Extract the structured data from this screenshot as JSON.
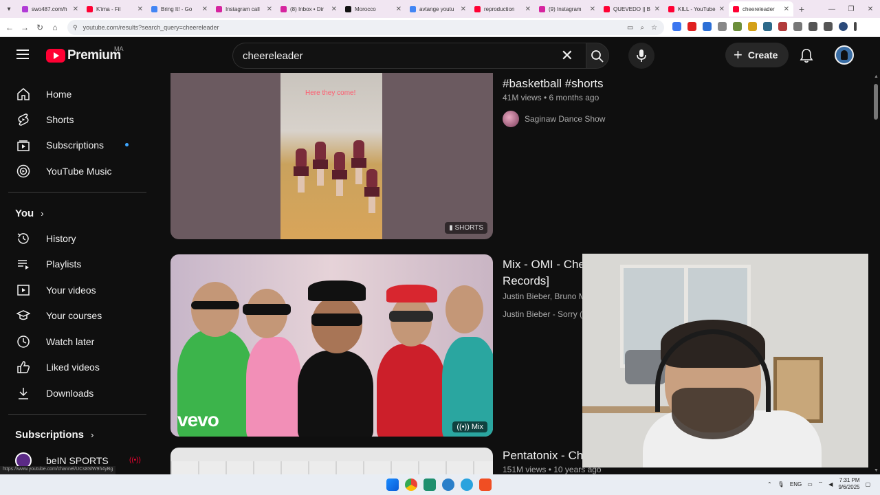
{
  "browser": {
    "tabs": [
      {
        "label": "swo487.com/h",
        "color": "#b13bd6"
      },
      {
        "label": "K'ima - Fil",
        "color": "#ff0033"
      },
      {
        "label": "Bring It! - Go",
        "color": "#4285f4"
      },
      {
        "label": "Instagram call",
        "color": "#d6249f"
      },
      {
        "label": "(8) Inbox • Dir",
        "color": "#d6249f"
      },
      {
        "label": "Morocco",
        "color": "#111111"
      },
      {
        "label": "avtange youtu",
        "color": "#4285f4"
      },
      {
        "label": "reproduction",
        "color": "#ff0033"
      },
      {
        "label": "(9) Instagram",
        "color": "#d6249f"
      },
      {
        "label": "QUEVEDO || B",
        "color": "#ff0033"
      },
      {
        "label": "KILL - YouTube",
        "color": "#ff0033"
      },
      {
        "label": "cheereleader",
        "color": "#ff0033",
        "active": true
      }
    ],
    "url": "youtube.com/results?search_query=cheereleader",
    "new_tab": "+"
  },
  "header": {
    "logo_text": "Premium",
    "country_code": "MA",
    "search_query": "cheereleader",
    "create_label": "Create"
  },
  "sidebar": {
    "main": [
      {
        "label": "Home",
        "icon": "home-icon"
      },
      {
        "label": "Shorts",
        "icon": "shorts-icon"
      },
      {
        "label": "Subscriptions",
        "icon": "subscriptions-icon"
      },
      {
        "label": "YouTube Music",
        "icon": "music-icon"
      }
    ],
    "you_heading": "You",
    "you": [
      {
        "label": "History",
        "icon": "history-icon"
      },
      {
        "label": "Playlists",
        "icon": "playlists-icon"
      },
      {
        "label": "Your videos",
        "icon": "your-videos-icon"
      },
      {
        "label": "Your courses",
        "icon": "courses-icon"
      },
      {
        "label": "Watch later",
        "icon": "clock-icon"
      },
      {
        "label": "Liked videos",
        "icon": "thumb-up-icon"
      },
      {
        "label": "Downloads",
        "icon": "download-icon"
      }
    ],
    "subscriptions_heading": "Subscriptions",
    "subscriptions": [
      {
        "label": "beIN SPORTS"
      }
    ],
    "status_url": "https://www.youtube.com/channel/UCs8SlW9h4yBg"
  },
  "results": [
    {
      "title": "#basketball #shorts",
      "meta": "41M views • 6 months ago",
      "channel": "Saginaw Dance Show",
      "badge": "SHORTS",
      "overlay_caption": "Here they come!"
    },
    {
      "title": "Mix - OMI - Chee",
      "title_line2": "Records]",
      "artists": "Justin Bieber, Bruno Ma",
      "next_track": "Justin Bieber - Sorry (P",
      "badge": "Mix",
      "thumb_brand": "vevo"
    },
    {
      "title": "Pentatonix - Che",
      "meta": "151M views • 10 years ago"
    }
  ],
  "taskbar": {
    "lang": "ENG",
    "time": "7:31 PM",
    "date": "9/6/2025"
  },
  "colors": {
    "accent_red": "#ff0033",
    "background": "#0f0f0f",
    "subscription_dot": "#3ea6ff"
  }
}
